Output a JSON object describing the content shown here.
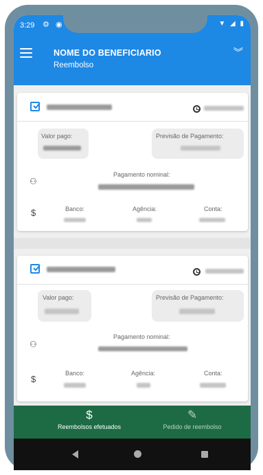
{
  "status_bar": {
    "time": "3:29",
    "left_icons": [
      "gear-icon",
      "alert-icon",
      "sim-icon"
    ],
    "right_icons": [
      "wifi-icon",
      "signal-icon",
      "battery-icon"
    ]
  },
  "app_bar": {
    "title": "NOME DO BENEFICIARIO",
    "subtitle": "Reembolso",
    "menu_icon": "menu-icon",
    "expand_icon": "chevron-double-down-icon"
  },
  "cards": [
    {
      "valor_pago_label": "Valor pago:",
      "previsao_label": "Previsão de Pagamento:",
      "pagamento_nominal_label": "Pagamento nominal:",
      "banco_label": "Banco:",
      "agencia_label": "Agência:",
      "conta_label": "Conta:"
    },
    {
      "valor_pago_label": "Valor pago:",
      "previsao_label": "Previsão de Pagamento:",
      "pagamento_nominal_label": "Pagamento nominal:",
      "banco_label": "Banco:",
      "agencia_label": "Agência:",
      "conta_label": "Conta:"
    }
  ],
  "bottom_nav": {
    "items": [
      {
        "label": "Reembolsos efetuados",
        "icon": "dollar-icon",
        "active": true
      },
      {
        "label": "Pedido de reembolso",
        "icon": "edit-icon",
        "active": false
      }
    ]
  },
  "colors": {
    "primary": "#1e88e5",
    "bottom_nav": "#1d6b45",
    "frame": "#6f8fa0"
  }
}
